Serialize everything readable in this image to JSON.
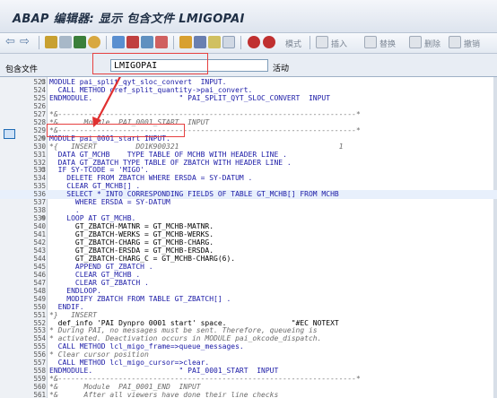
{
  "window": {
    "title": "ABAP 编辑器: 显示 包含文件 LMIGOPAI"
  },
  "toolbar": {
    "buttons": [
      "back-icon",
      "forward-icon",
      "toggle-display-change-icon",
      "other-object-icon",
      "activate-icon",
      "check-icon",
      "test-icon",
      "where-used-icon",
      "display-object-list-icon",
      "navigation-window-icon",
      "pretty-printer-icon",
      "find-icon",
      "help-icon",
      "set-breakpoint-icon",
      "set-external-breakpoint-icon"
    ],
    "pattern_label": "模式",
    "insert_label": "插入",
    "replace_label": "替换",
    "delete_label": "删除",
    "undo_label": "撤销"
  },
  "include": {
    "label": "包含文件",
    "value": "LMIGOPAI",
    "status": "活动"
  },
  "editor": {
    "lines": [
      {
        "n": "523",
        "t": "MODULE pai_split_qyt_sloc_convert  INPUT.",
        "k": "kw"
      },
      {
        "n": "524",
        "t": "  CALL METHOD oref_split_quantity->pai_convert.",
        "k": "kw"
      },
      {
        "n": "525",
        "t": "ENDMODULE.                    \" PAI_SPLIT_QYT_SLOC_CONVERT  INPUT",
        "k": "kw"
      },
      {
        "n": "526",
        "t": "",
        "k": "norm"
      },
      {
        "n": "527",
        "t": "*&---------------------------------------------------------------------*",
        "k": "cmt"
      },
      {
        "n": "528",
        "t": "*&      Module  PAI_0001_START  INPUT",
        "k": "cmt"
      },
      {
        "n": "529",
        "t": "*&---------------------------------------------------------------------*",
        "k": "cmt"
      },
      {
        "n": "529",
        "t": "MODULE pai_0001_start INPUT.",
        "k": "kw"
      },
      {
        "n": "530",
        "t": "*{   INSERT         DO1K900321                                     1",
        "k": "cmt"
      },
      {
        "n": "531",
        "t": "  DATA GT_MCHB    TYPE TABLE OF MCHB WITH HEADER LINE .",
        "k": "kw"
      },
      {
        "n": "532",
        "t": "  DATA GT_ZBATCH TYPE TABLE OF ZBATCH WITH HEADER LINE .",
        "k": "kw"
      },
      {
        "n": "533",
        "t": "  IF SY-TCODE = 'MIGO'.",
        "k": "kw"
      },
      {
        "n": "534",
        "t": "    DELETE FROM ZBATCH WHERE ERSDA = SY-DATUM .",
        "k": "kw"
      },
      {
        "n": "535",
        "t": "    CLEAR GT_MCHB[] .",
        "k": "kw"
      },
      {
        "n": "536",
        "t": "    SELECT * INTO CORRESPONDING FIELDS OF TABLE GT_MCHB[] FROM MCHB",
        "k": "kw"
      },
      {
        "n": "537",
        "t": "      WHERE ERSDA = SY-DATUM",
        "k": "kw"
      },
      {
        "n": "538",
        "t": "      .",
        "k": "kw"
      },
      {
        "n": "539",
        "t": "    LOOP AT GT_MCHB.",
        "k": "kw"
      },
      {
        "n": "540",
        "t": "      GT_ZBATCH-MATNR = GT_MCHB-MATNR.",
        "k": "norm"
      },
      {
        "n": "541",
        "t": "      GT_ZBATCH-WERKS = GT_MCHB-WERKS.",
        "k": "norm"
      },
      {
        "n": "542",
        "t": "      GT_ZBATCH-CHARG = GT_MCHB-CHARG.",
        "k": "norm"
      },
      {
        "n": "543",
        "t": "      GT_ZBATCH-ERSDA = GT_MCHB-ERSDA.",
        "k": "norm"
      },
      {
        "n": "544",
        "t": "      GT_ZBATCH-CHARG_C = GT_MCHB-CHARG(6).",
        "k": "norm"
      },
      {
        "n": "545",
        "t": "      APPEND GT_ZBATCH .",
        "k": "kw"
      },
      {
        "n": "546",
        "t": "      CLEAR GT_MCHB .",
        "k": "kw"
      },
      {
        "n": "547",
        "t": "      CLEAR GT_ZBATCH .",
        "k": "kw"
      },
      {
        "n": "548",
        "t": "    ENDLOOP.",
        "k": "kw"
      },
      {
        "n": "549",
        "t": "    MODIFY ZBATCH FROM TABLE GT_ZBATCH[] .",
        "k": "kw"
      },
      {
        "n": "550",
        "t": "  ENDIF.",
        "k": "kw"
      },
      {
        "n": "551",
        "t": "*}   INSERT",
        "k": "cmt"
      },
      {
        "n": "552",
        "t": "  def_info 'PAI Dynpro 0001 start' space.               \"#EC NOTEXT",
        "k": "norm"
      },
      {
        "n": "553",
        "t": "* During PAI, no messages must be sent. Therefore, queueing is",
        "k": "cmt"
      },
      {
        "n": "554",
        "t": "* activated. Deactivation occurs in MODULE pai_okcode_dispatch.",
        "k": "cmt"
      },
      {
        "n": "555",
        "t": "  CALL METHOD lcl_migo_frame=>queue_messages.",
        "k": "kw"
      },
      {
        "n": "556",
        "t": "* Clear cursor position",
        "k": "cmt"
      },
      {
        "n": "557",
        "t": "  CALL METHOD lcl_migo_cursor=>clear.",
        "k": "kw"
      },
      {
        "n": "558",
        "t": "ENDMODULE.                    \" PAI_0001_START  INPUT",
        "k": "kw"
      },
      {
        "n": "559",
        "t": "*&---------------------------------------------------------------------*",
        "k": "cmt"
      },
      {
        "n": "560",
        "t": "*&      Module  PAI_0001_END  INPUT",
        "k": "cmt"
      },
      {
        "n": "561",
        "t": "*&      After all viewers have done their line checks",
        "k": "cmt"
      }
    ]
  }
}
